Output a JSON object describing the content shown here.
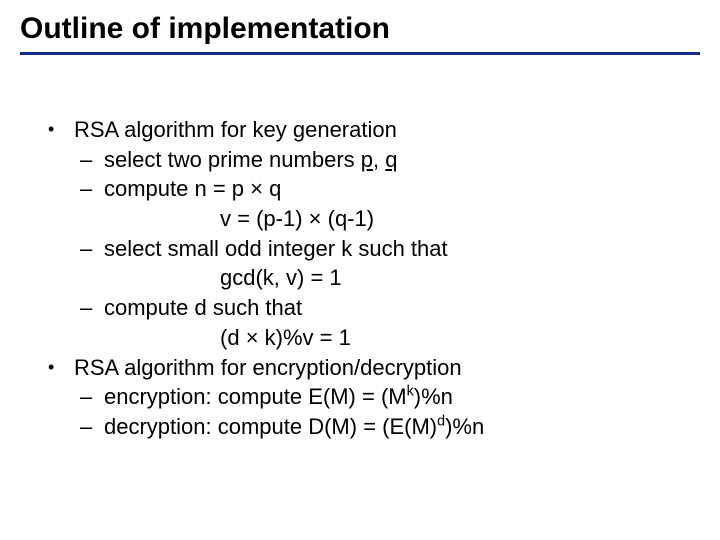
{
  "title": "Outline of implementation",
  "bullets": {
    "b1": "RSA algorithm for key generation",
    "b1s1a": "select two prime numbers ",
    "b1s1b": "p",
    "b1s1c": ", ",
    "b1s1d": "q",
    "b1s2a": "compute  n = p ",
    "b1s2b": "×",
    "b1s2c": " q",
    "b1s2d": "v = (p-1) ",
    "b1s2e": "×",
    "b1s2f": " (q-1)",
    "b1s3": "select small odd integer k such that",
    "b1s3b": "gcd(k, v) = 1",
    "b1s4": "compute d such that",
    "b1s4b_a": "(d ",
    "b1s4b_b": "×",
    "b1s4b_c": " k)%v = 1",
    "b2": "RSA algorithm for encryption/decryption",
    "b2s1a": "encryption:  compute E(M) = (M",
    "b2s1b": "k",
    "b2s1c": ")%n",
    "b2s2a": "decryption:  compute D(M) = (E(M)",
    "b2s2b": "d",
    "b2s2c": ")%n"
  },
  "glyphs": {
    "bullet": "•",
    "dash": "–"
  }
}
